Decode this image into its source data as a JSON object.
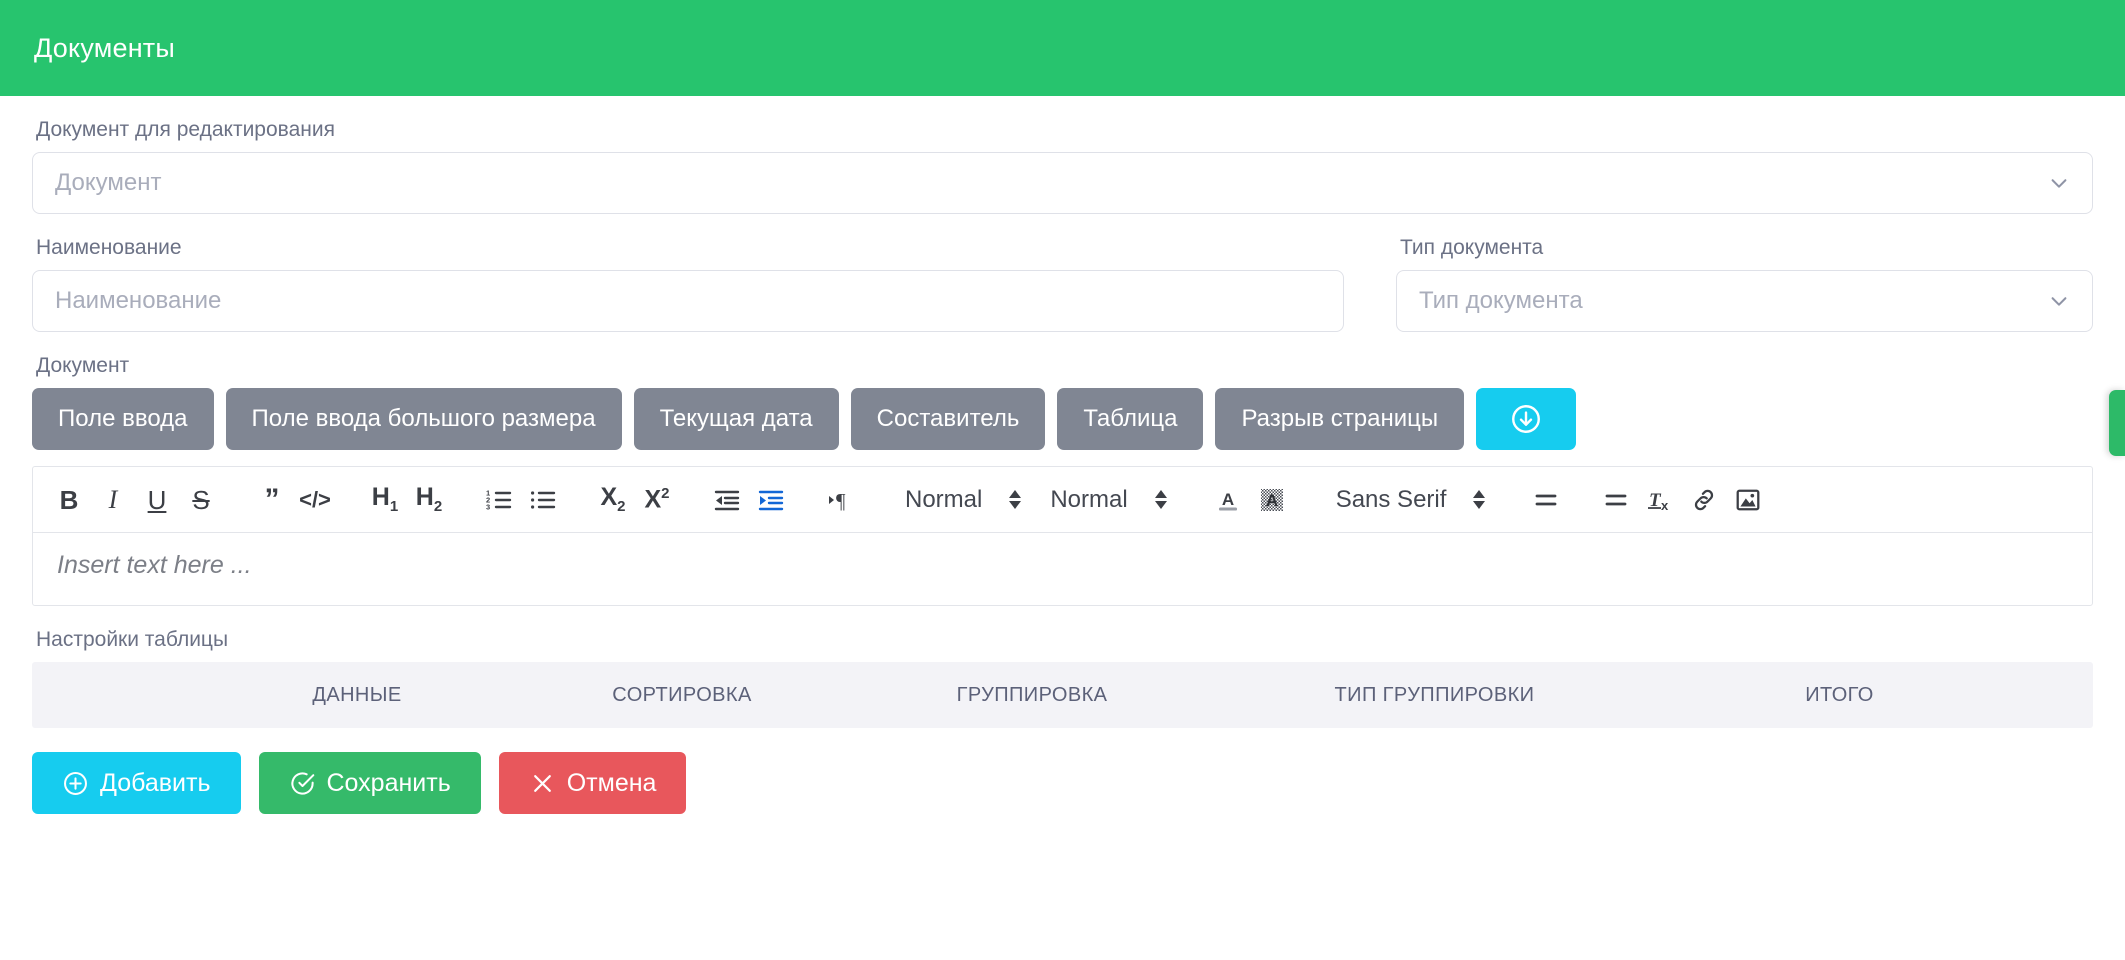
{
  "header": {
    "title": "Документы",
    "bg_color": "#27c46e"
  },
  "form": {
    "doc_select_label": "Документ для редактирования",
    "doc_select_value": "Документ",
    "name_label": "Наименование",
    "name_placeholder": "Наименование",
    "doc_type_label": "Тип документа",
    "doc_type_value": "Тип документа"
  },
  "document_section": {
    "label": "Документ",
    "chips": [
      {
        "label": "Поле ввода"
      },
      {
        "label": "Поле ввода большого размера"
      },
      {
        "label": "Текущая дата"
      },
      {
        "label": "Составитель"
      },
      {
        "label": "Таблица"
      },
      {
        "label": "Разрыв страницы"
      }
    ],
    "download_button": {
      "icon": "download-circle-icon",
      "color": "#16ccef"
    }
  },
  "editor": {
    "placeholder": "Insert text here ...",
    "toolbar": {
      "bold": "B",
      "italic": "I",
      "underline": "U",
      "strike": "S",
      "blockquote": "”",
      "code": "</>",
      "h1": "H1",
      "h2": "H2",
      "ordered_list": "ordered-list-icon",
      "bullet_list": "bullet-list-icon",
      "subscript": "X2",
      "superscript": "X2",
      "outdent": "outdent-icon",
      "indent": "indent-icon",
      "direction": "text-direction-icon",
      "size_select": "Normal",
      "header_select": "Normal",
      "text_color": "text-color-icon",
      "background_color": "background-color-icon",
      "font_select": "Sans Serif",
      "align": "align-icon",
      "clear_format": "clear-format-icon",
      "link": "link-icon",
      "image": "image-icon"
    },
    "active_tool_color": "#1367d6"
  },
  "table_settings": {
    "label": "Настройки таблицы",
    "columns": [
      "",
      "ДАННЫЕ",
      "СОРТИРОВКА",
      "ГРУППИРОВКА",
      "ТИП ГРУППИРОВКИ",
      "ИТОГО"
    ],
    "rows": []
  },
  "actions": [
    {
      "label": "Добавить",
      "icon": "plus-circle-icon",
      "color": "#16ccef"
    },
    {
      "label": "Сохранить",
      "icon": "check-circle-icon",
      "color": "#35ba6a"
    },
    {
      "label": "Отмена",
      "icon": "close-icon",
      "color": "#e8575c"
    }
  ],
  "edge_tab": {
    "color": "#2dba68"
  }
}
